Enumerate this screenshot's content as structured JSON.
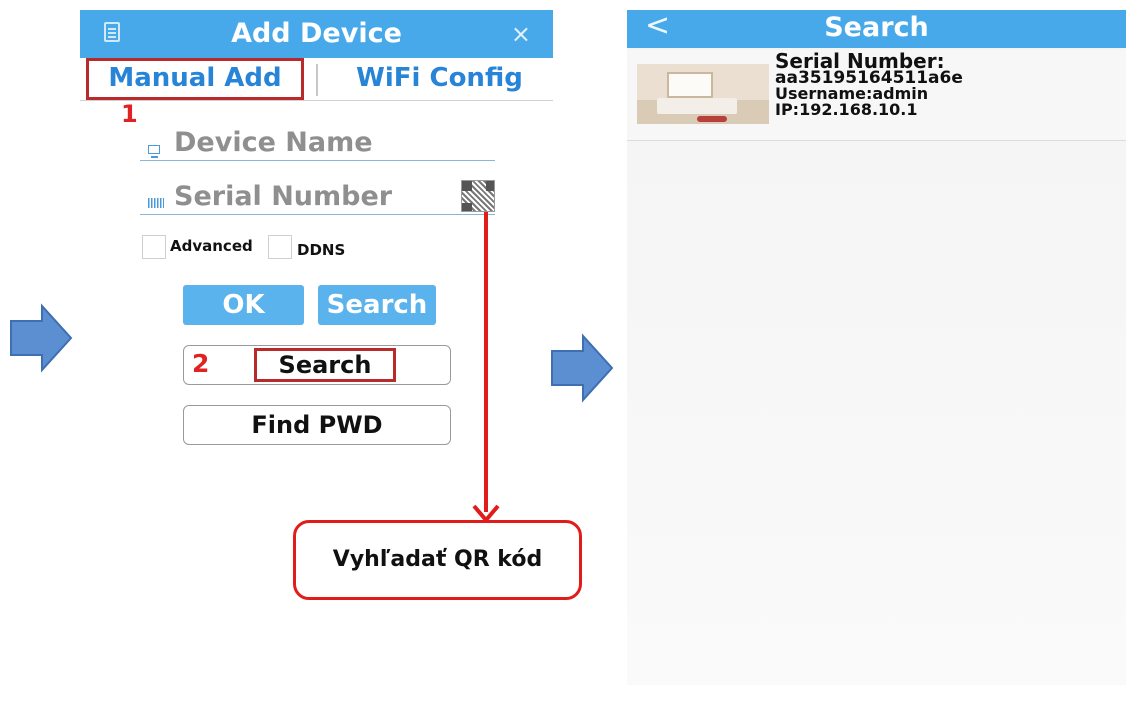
{
  "left_panel": {
    "header": {
      "title": "Add Device",
      "menu_icon": "menu-icon",
      "close_glyph": "×"
    },
    "tabs": {
      "manual": "Manual Add",
      "wifi": "WiFi Config"
    },
    "step_1": "1",
    "device_name_placeholder": "Device Name",
    "serial_number_placeholder": "Serial Number",
    "advanced_label": "Advanced",
    "ddns_label": "DDNS",
    "ok_label": "OK",
    "search_label_blue": "Search",
    "step_2": "2",
    "search_label": "Search",
    "find_pwd_label": "Find PWD"
  },
  "callout": {
    "text": "Vyhľadať QR kód"
  },
  "right_panel": {
    "header": {
      "title": "Search",
      "back_glyph": "<"
    },
    "result": {
      "serial_label": "Serial Number:",
      "serial_value": "aa35195164511a6e",
      "username": "Username:admin",
      "ip": "IP:192.168.10.1"
    }
  },
  "colors": {
    "header_blue": "#47a9ea",
    "button_blue": "#5ab3ec",
    "annotation_red": "#e21b1b",
    "arrow_blue": "#5b8fd2"
  }
}
